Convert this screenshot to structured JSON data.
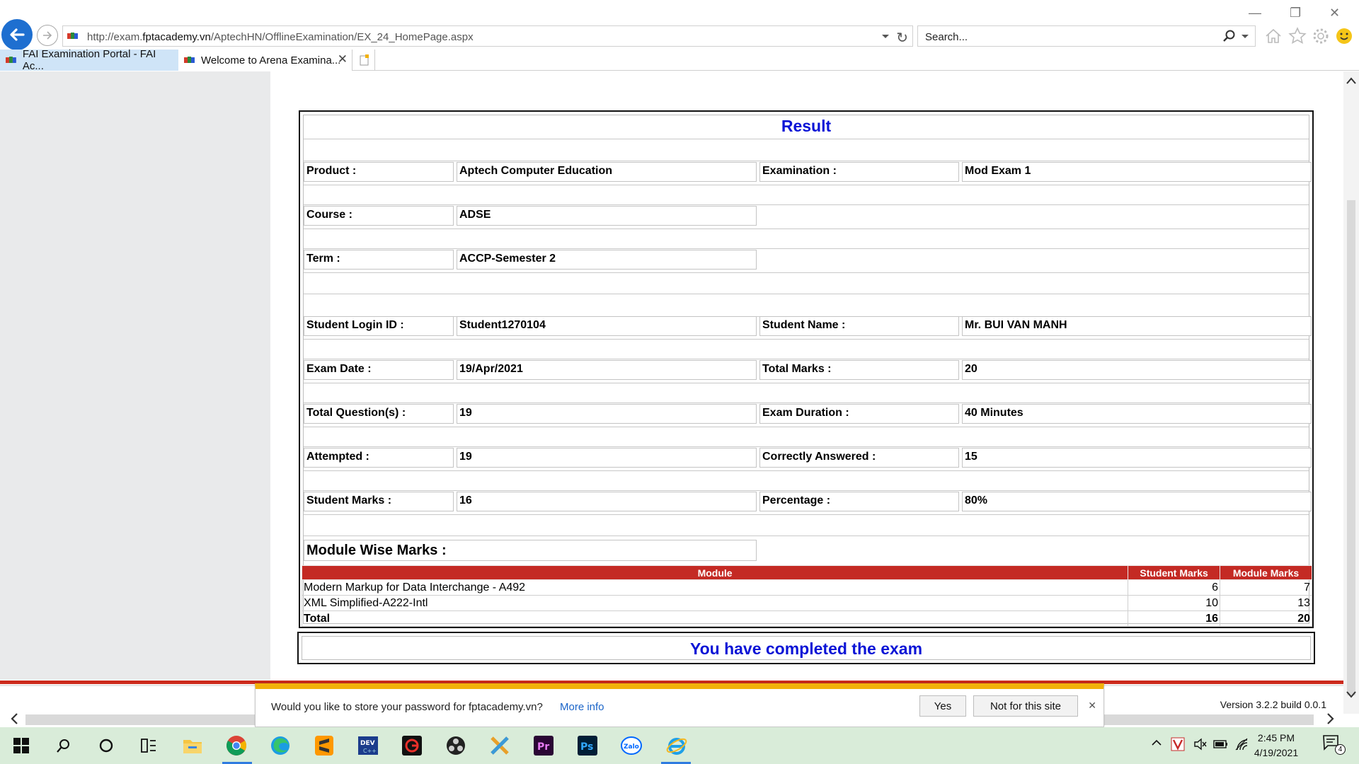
{
  "browser": {
    "url_prefix": "http://exam.",
    "url_domain": "fptacademy.vn",
    "url_path": "/AptechHN/OfflineExamination/EX_24_HomePage.aspx",
    "search_placeholder": "Search...",
    "tabs": [
      {
        "label": "FAI Examination Portal - FAI Ac..."
      },
      {
        "label": "Welcome to Arena Examina..."
      }
    ]
  },
  "result": {
    "title": "Result",
    "fields": {
      "product_label": "Product :",
      "product_value": "Aptech Computer Education",
      "exam_label": "Examination :",
      "exam_value": "Mod Exam 1",
      "course_label": "Course :",
      "course_value": "ADSE",
      "term_label": "Term :",
      "term_value": "ACCP-Semester 2",
      "login_label": "Student Login ID :",
      "login_value": "Student1270104",
      "name_label": "Student Name :",
      "name_value": "Mr. BUI VAN MANH",
      "date_label": "Exam Date :",
      "date_value": "19/Apr/2021",
      "total_marks_label": "Total Marks :",
      "total_marks_value": "20",
      "questions_label": "Total Question(s) :",
      "questions_value": "19",
      "duration_label": "Exam Duration :",
      "duration_value": "40 Minutes",
      "attempted_label": "Attempted :",
      "attempted_value": "19",
      "correct_label": "Correctly Answered :",
      "correct_value": "15",
      "student_marks_label": "Student Marks :",
      "student_marks_value": "16",
      "percentage_label": "Percentage :",
      "percentage_value": "80%"
    },
    "module_wise_label": "Module Wise Marks :",
    "module_table": {
      "headers": [
        "Module",
        "Student Marks",
        "Module Marks"
      ],
      "rows": [
        {
          "module": "Modern Markup for Data Interchange - A492",
          "student": "6",
          "max": "7"
        },
        {
          "module": "XML Simplified-A222-Intl",
          "student": "10",
          "max": "13"
        }
      ],
      "total": {
        "label": "Total",
        "student": "16",
        "max": "20"
      }
    },
    "completed_msg": "You have completed the exam"
  },
  "version": "Version 3.2.2 build 0.0.1",
  "password_bar": {
    "message": "Would you like to store your password for fptacademy.vn?",
    "more_info": "More info",
    "yes": "Yes",
    "no": "Not for this site"
  },
  "taskbar": {
    "time": "2:45 PM",
    "date": "4/19/2021",
    "notification_count": "4",
    "icons": [
      "windows-start-icon",
      "search-icon",
      "cortana-icon",
      "task-view-icon",
      "file-explorer-icon",
      "chrome-icon",
      "edge-icon",
      "sublime-text-icon",
      "devcpp-icon",
      "garena-icon",
      "obs-icon",
      "xmind-icon",
      "premiere-icon",
      "photoshop-icon",
      "zalo-icon",
      "internet-explorer-icon"
    ]
  },
  "colors": {
    "accent_blue": "#0b14d6",
    "table_header_red": "#c42a24",
    "ie_blue": "#1e6fd0",
    "notification_yellow": "#f2b10a",
    "taskbar_bg": "#d9ecd9"
  }
}
